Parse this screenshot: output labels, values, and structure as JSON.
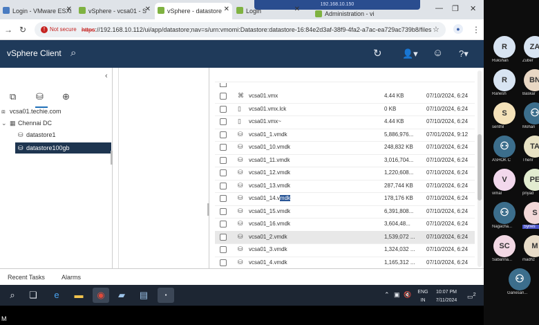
{
  "browser": {
    "tabs": [
      {
        "label": "Login - VMware ESXi",
        "icon_color": "#4a7cc1"
      },
      {
        "label": "vSphere - vcsa01 - S",
        "icon_color": "#7fb241"
      },
      {
        "label": "vSphere - datastore",
        "icon_color": "#7fb241"
      },
      {
        "label": "Login",
        "icon_color": "#7fb241"
      },
      {
        "label": "Administration - vi",
        "icon_color": "#7fb241"
      }
    ],
    "remote_session_ip": "192.168.10.150",
    "not_secure_label": "Not secure",
    "url_proto": "https",
    "url_rest": "://192.168.10.112/ui/app/datastore;nav=s/urn:vmomi:Datastore:datastore-16:84e2d3af-38f9-4fa2-a7ac-ea729ac739b8/files"
  },
  "vsphere": {
    "title": "vSphere Client",
    "tree": {
      "vcenter": "vcsa01.techie.com",
      "datacenter": "Chennai DC",
      "datastores": [
        "datastore1",
        "datastore100gb"
      ],
      "selected": "datastore100gb"
    },
    "files": [
      {
        "icon": "vmx-icon",
        "glyph": "⌘",
        "name": "vcsa01.vmx",
        "size": "4.44 KB",
        "date": "07/10/2024, 6:24"
      },
      {
        "icon": "file-icon",
        "glyph": "▯",
        "name": "vcsa01.vmx.lck",
        "size": "0 KB",
        "date": "07/10/2024, 6:24"
      },
      {
        "icon": "file-icon",
        "glyph": "▯",
        "name": "vcsa01.vmx~",
        "size": "4.44 KB",
        "date": "07/10/2024, 6:24"
      },
      {
        "icon": "disk-icon",
        "glyph": "⛁",
        "name": "vcsa01_1.vmdk",
        "size": "5,886,976...",
        "date": "07/01/2024, 9:12"
      },
      {
        "icon": "disk-icon",
        "glyph": "⛁",
        "name": "vcsa01_10.vmdk",
        "size": "248,832 KB",
        "date": "07/10/2024, 6:24"
      },
      {
        "icon": "disk-icon",
        "glyph": "⛁",
        "name": "vcsa01_11.vmdk",
        "size": "3,016,704...",
        "date": "07/10/2024, 6:24"
      },
      {
        "icon": "disk-icon",
        "glyph": "⛁",
        "name": "vcsa01_12.vmdk",
        "size": "1,220,608...",
        "date": "07/10/2024, 6:24"
      },
      {
        "icon": "disk-icon",
        "glyph": "⛁",
        "name": "vcsa01_13.vmdk",
        "size": "287,744 KB",
        "date": "07/10/2024, 6:24"
      },
      {
        "icon": "disk-icon",
        "glyph": "⛁",
        "name_pre": "vcsa01_14.v",
        "name_hl": "mdk",
        "size": "178,176 KB",
        "date": "07/10/2024, 6:24"
      },
      {
        "icon": "disk-icon",
        "glyph": "⛁",
        "name": "vcsa01_15.vmdk",
        "size": "6,391,808...",
        "date": "07/10/2024, 6:24"
      },
      {
        "icon": "disk-icon",
        "glyph": "⛁",
        "name": "vcsa01_16.vmdk",
        "size": "3,604,48...",
        "date": "07/10/2024, 6:24"
      },
      {
        "icon": "disk-icon",
        "glyph": "⛁",
        "name": "vcsa01_2.vmdk",
        "size": "1,539,072 ...",
        "date": "07/10/2024, 6:24"
      },
      {
        "icon": "disk-icon",
        "glyph": "⛁",
        "name": "vcsa01_3.vmdk",
        "size": "1,324,032 ...",
        "date": "07/10/2024, 6:24"
      },
      {
        "icon": "disk-icon",
        "glyph": "⛁",
        "name": "vcsa01_4.vmdk",
        "size": "1,165,312 ...",
        "date": "07/10/2024, 6:24"
      }
    ],
    "bottom_tabs": [
      "Recent Tasks",
      "Alarms"
    ]
  },
  "taskbar": {
    "lang": "ENG",
    "region": "IN",
    "time": "10:07 PM",
    "date": "7/11/2024",
    "notification_count": "2"
  },
  "participants": [
    {
      "initials": "R",
      "name": "Rukshan",
      "color": "#d8e4f2"
    },
    {
      "initials": "ZA",
      "name": "Zuber",
      "color": "#d8e4f2"
    },
    {
      "initials": "R",
      "name": "Ranesh",
      "color": "#d8e4f2"
    },
    {
      "initials": "BN",
      "name": "Baskar",
      "color": "#e8d7c4"
    },
    {
      "initials": "S",
      "name": "senthil",
      "color": "#f4e2b9"
    },
    {
      "initials": "",
      "name": "Mohan",
      "color": "#3c6e8c"
    },
    {
      "initials": "",
      "name": "ASHOK C",
      "color": "#3c6e8c"
    },
    {
      "initials": "TA",
      "name": "Thenr",
      "color": "#e8e2c4"
    },
    {
      "initials": "V",
      "name": "vimal",
      "color": "#f2d8ec"
    },
    {
      "initials": "PE",
      "name": "priyad",
      "color": "#e2ecd0"
    },
    {
      "initials": "",
      "name": "Nagacha...",
      "color": "#3c6e8c"
    },
    {
      "initials": "S",
      "name": "Synes",
      "color": "#f2d8d8"
    },
    {
      "initials": "SC",
      "name": "Sabarina...",
      "color": "#f2d8e4"
    },
    {
      "initials": "M",
      "name": "madhz",
      "color": "#e8dcc8"
    },
    {
      "initials": "",
      "name": "Ganesan...",
      "color": "#3c6e8c"
    }
  ],
  "corner_label": "M"
}
